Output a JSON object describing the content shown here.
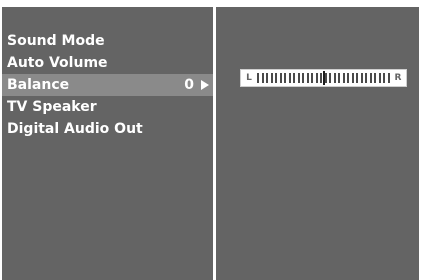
{
  "menu": {
    "items": [
      {
        "label": "Sound Mode",
        "value": "",
        "selected": false
      },
      {
        "label": "Auto Volume",
        "value": "",
        "selected": false
      },
      {
        "label": "Balance",
        "value": "0",
        "selected": true
      },
      {
        "label": "TV Speaker",
        "value": "",
        "selected": false
      },
      {
        "label": "Digital Audio Out",
        "value": "",
        "selected": false
      }
    ]
  },
  "balance": {
    "left_label": "L",
    "right_label": "R",
    "value": 0,
    "min": -50,
    "max": 50,
    "tick_count": 30
  },
  "colors": {
    "panel": "#646464",
    "highlight": "#8a8a8a",
    "text": "#ffffff"
  }
}
